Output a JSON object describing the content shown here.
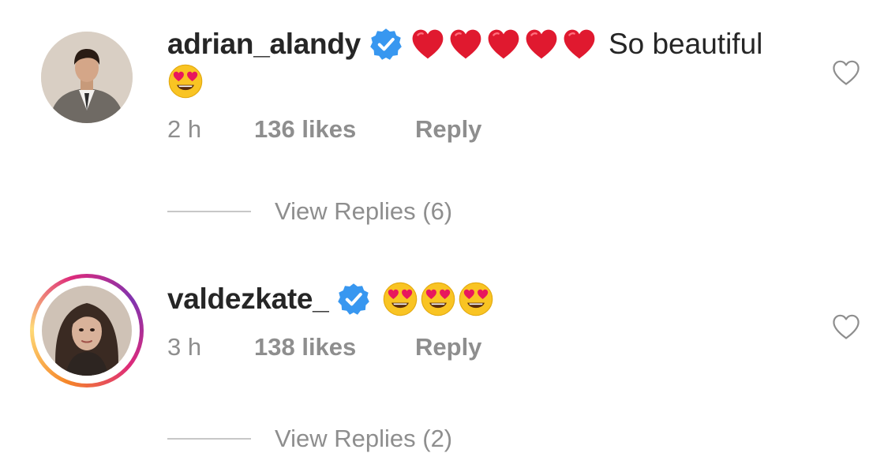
{
  "comments": [
    {
      "username": "adrian_alandy",
      "verified": true,
      "emojis_inline": [
        "red-heart",
        "red-heart",
        "red-heart",
        "red-heart",
        "red-heart"
      ],
      "text": "So beautiful",
      "emojis_wrapped": [
        "heart-eyes"
      ],
      "time": "2 h",
      "likes": "136 likes",
      "reply_label": "Reply",
      "view_replies": "View Replies (6)"
    },
    {
      "username": "valdezkate_",
      "verified": true,
      "has_story_ring": true,
      "emojis_inline": [
        "heart-eyes",
        "heart-eyes",
        "heart-eyes"
      ],
      "time": "3 h",
      "likes": "138 likes",
      "reply_label": "Reply",
      "view_replies": "View Replies (2)"
    }
  ],
  "colors": {
    "verified_badge": "#3897f0",
    "meta_text": "#8e8e8e",
    "username_text": "#262626",
    "heart_emoji": "#e0192f",
    "story_ring": [
      "#f58529",
      "#dd2a7b",
      "#8134af"
    ]
  }
}
